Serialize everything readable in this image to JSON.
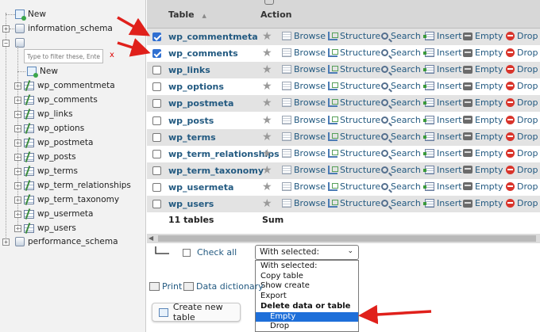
{
  "sidebar": {
    "new_top": "New",
    "databases": [
      "information_schema",
      "performance_schema"
    ],
    "filter_placeholder": "Type to filter these, Enter to s",
    "filter_clear": "x",
    "new_table": "New",
    "tables": [
      "wp_commentmeta",
      "wp_comments",
      "wp_links",
      "wp_options",
      "wp_postmeta",
      "wp_posts",
      "wp_terms",
      "wp_term_relationships",
      "wp_term_taxonomy",
      "wp_usermeta",
      "wp_users"
    ]
  },
  "table_header": {
    "table_col": "Table",
    "sort_icon": "▲",
    "action_col": "Action"
  },
  "actions": {
    "browse": "Browse",
    "structure": "Structure",
    "search": "Search",
    "insert": "Insert",
    "empty": "Empty",
    "drop": "Drop"
  },
  "rows": [
    {
      "name": "wp_commentmeta",
      "checked": true
    },
    {
      "name": "wp_comments",
      "checked": true
    },
    {
      "name": "wp_links",
      "checked": false
    },
    {
      "name": "wp_options",
      "checked": false
    },
    {
      "name": "wp_postmeta",
      "checked": false
    },
    {
      "name": "wp_posts",
      "checked": false
    },
    {
      "name": "wp_terms",
      "checked": false
    },
    {
      "name": "wp_term_relationships",
      "checked": false
    },
    {
      "name": "wp_term_taxonomy",
      "checked": false
    },
    {
      "name": "wp_usermeta",
      "checked": false
    },
    {
      "name": "wp_users",
      "checked": false
    }
  ],
  "summary": {
    "count": "11 tables",
    "sum": "Sum"
  },
  "bulk": {
    "check_all": "Check all",
    "with_selected": "With selected:",
    "chevron": "⌄",
    "options": [
      {
        "label": "With selected:",
        "kind": "plain"
      },
      {
        "label": "Copy table",
        "kind": "plain"
      },
      {
        "label": "Show create",
        "kind": "plain"
      },
      {
        "label": "Export",
        "kind": "plain"
      },
      {
        "label": "Delete data or table",
        "kind": "group"
      },
      {
        "label": "Empty",
        "kind": "indent-highlight"
      },
      {
        "label": "Drop",
        "kind": "indent"
      }
    ]
  },
  "footer": {
    "print": "Print",
    "data_dictionary": "Data dictionary",
    "create_table": "Create new table"
  },
  "colors": {
    "link": "#235a81",
    "header_bg": "#d7d7d7",
    "odd_row": "#e3e3e3",
    "highlight": "#1e6fd9",
    "annotation_arrow": "#e0201b"
  }
}
